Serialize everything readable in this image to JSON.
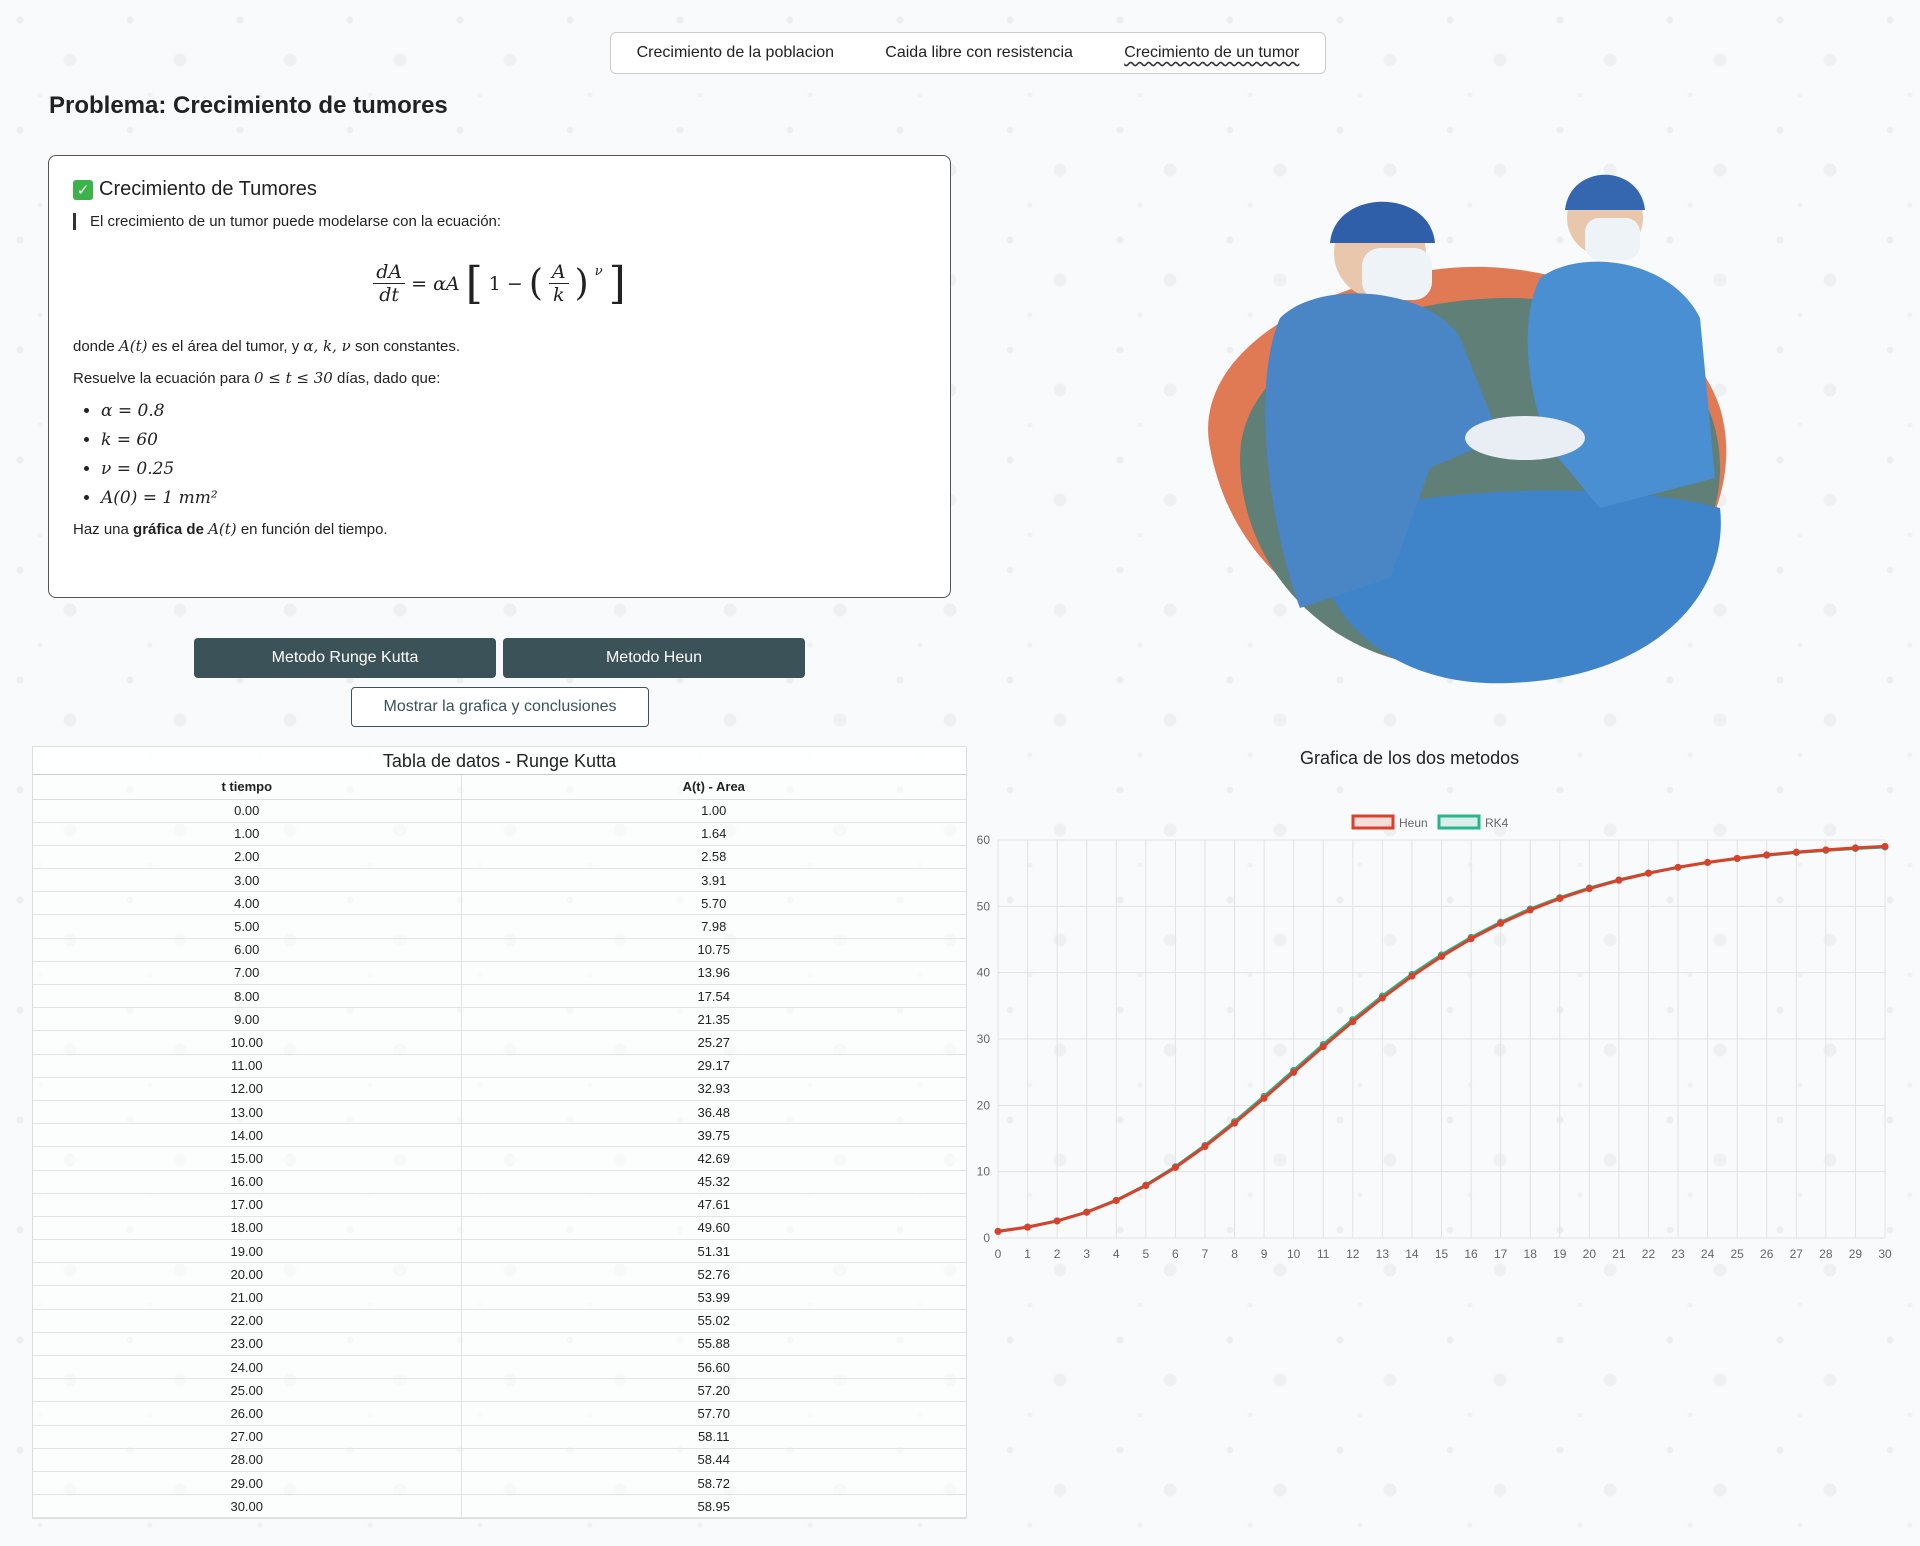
{
  "nav": {
    "items": [
      "Crecimiento de la poblacion",
      "Caida libre con resistencia",
      "Crecimiento de un tumor"
    ],
    "active_index": 2
  },
  "page_title": "Problema: Crecimiento de tumores",
  "card": {
    "title": "Crecimiento de Tumores",
    "intro": "El crecimiento de un tumor puede modelarse con la ecuación:",
    "formula": {
      "lhs_num": "dA",
      "lhs_den": "dt",
      "equals": "= αA",
      "bracket_open": "[",
      "one_minus": "1 −",
      "paren_open": "(",
      "inner_num": "A",
      "inner_den": "k",
      "paren_close": ")",
      "exponent": "ν",
      "bracket_close": "]"
    },
    "where_pre": "donde ",
    "where_fn": "A(t)",
    "where_mid": " es el área del tumor, y ",
    "where_consts": "α, k, ν",
    "where_post": " son constantes.",
    "solve_pre": "Resuelve la ecuación para ",
    "solve_range": "0 ≤ t ≤ 30",
    "solve_post": " días, dado que:",
    "params": [
      "α = 0.8",
      "k = 60",
      "ν = 0.25",
      "A(0) = 1 mm²"
    ],
    "plot_pre": "Haz una ",
    "plot_bold": "gráfica de ",
    "plot_fn": "A(t)",
    "plot_post": " en función del tiempo."
  },
  "buttons": {
    "rk": "Metodo Runge Kutta",
    "heun": "Metodo Heun",
    "show": "Mostrar la grafica y conclusiones"
  },
  "table": {
    "caption": "Tabla de datos - Runge Kutta",
    "headers": [
      "t tiempo",
      "A(t) - Area"
    ],
    "rows": [
      [
        "0.00",
        "1.00"
      ],
      [
        "1.00",
        "1.64"
      ],
      [
        "2.00",
        "2.58"
      ],
      [
        "3.00",
        "3.91"
      ],
      [
        "4.00",
        "5.70"
      ],
      [
        "5.00",
        "7.98"
      ],
      [
        "6.00",
        "10.75"
      ],
      [
        "7.00",
        "13.96"
      ],
      [
        "8.00",
        "17.54"
      ],
      [
        "9.00",
        "21.35"
      ],
      [
        "10.00",
        "25.27"
      ],
      [
        "11.00",
        "29.17"
      ],
      [
        "12.00",
        "32.93"
      ],
      [
        "13.00",
        "36.48"
      ],
      [
        "14.00",
        "39.75"
      ],
      [
        "15.00",
        "42.69"
      ],
      [
        "16.00",
        "45.32"
      ],
      [
        "17.00",
        "47.61"
      ],
      [
        "18.00",
        "49.60"
      ],
      [
        "19.00",
        "51.31"
      ],
      [
        "20.00",
        "52.76"
      ],
      [
        "21.00",
        "53.99"
      ],
      [
        "22.00",
        "55.02"
      ],
      [
        "23.00",
        "55.88"
      ],
      [
        "24.00",
        "56.60"
      ],
      [
        "25.00",
        "57.20"
      ],
      [
        "26.00",
        "57.70"
      ],
      [
        "27.00",
        "58.11"
      ],
      [
        "28.00",
        "58.44"
      ],
      [
        "29.00",
        "58.72"
      ],
      [
        "30.00",
        "58.95"
      ]
    ]
  },
  "chart_title": "Grafica de los dos metodos",
  "colors": {
    "heun": "#d9412b",
    "rk4": "#27b58b",
    "dark_button": "#3b5358"
  },
  "chart_data": {
    "type": "line",
    "title": "Grafica de los dos metodos",
    "xlabel": "",
    "ylabel": "",
    "x": [
      0,
      1,
      2,
      3,
      4,
      5,
      6,
      7,
      8,
      9,
      10,
      11,
      12,
      13,
      14,
      15,
      16,
      17,
      18,
      19,
      20,
      21,
      22,
      23,
      24,
      25,
      26,
      27,
      28,
      29,
      30
    ],
    "ylim": [
      0,
      60
    ],
    "yticks": [
      0,
      10,
      20,
      30,
      40,
      50,
      60
    ],
    "grid": true,
    "legend": "top",
    "series": [
      {
        "name": "Heun",
        "color": "#d9412b",
        "values": [
          1.0,
          1.64,
          2.57,
          3.88,
          5.65,
          7.9,
          10.63,
          13.79,
          17.31,
          21.07,
          24.96,
          28.85,
          32.62,
          36.18,
          39.47,
          42.44,
          45.1,
          47.43,
          49.45,
          51.19,
          52.67,
          53.93,
          54.99,
          55.88,
          56.62,
          57.23,
          57.75,
          58.17,
          58.52,
          58.81,
          59.04
        ]
      },
      {
        "name": "RK4",
        "color": "#27b58b",
        "values": [
          1.0,
          1.64,
          2.58,
          3.91,
          5.7,
          7.98,
          10.75,
          13.96,
          17.54,
          21.35,
          25.27,
          29.17,
          32.93,
          36.48,
          39.75,
          42.69,
          45.32,
          47.61,
          49.6,
          51.31,
          52.76,
          53.99,
          55.02,
          55.88,
          56.6,
          57.2,
          57.7,
          58.11,
          58.44,
          58.72,
          58.95
        ]
      }
    ]
  }
}
